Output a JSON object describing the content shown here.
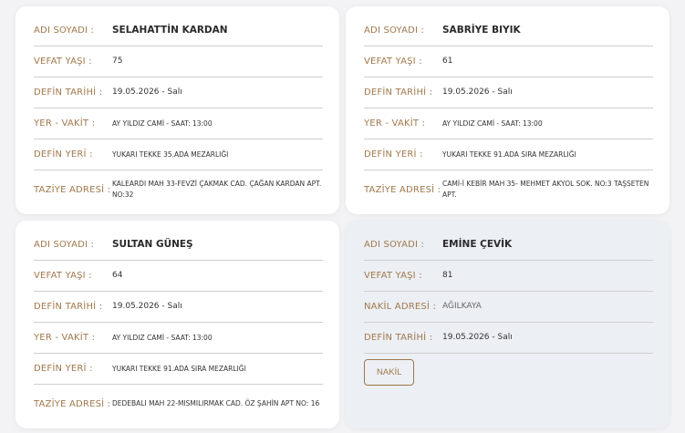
{
  "labels": {
    "name": "ADI SOYADI :",
    "age": "VEFAT YAŞI :",
    "date": "DEFİN TARİHİ :",
    "place_time": "YER - VAKİT :",
    "burial_place": "DEFİN YERİ :",
    "condolence": "TAZİYE ADRESİ :",
    "transfer": "NAKİL ADRESİ :",
    "transfer_button": "NAKİL"
  },
  "cards": [
    {
      "name": "SELAHATTİN KARDAN",
      "age": "75",
      "date": "19.05.2026 - Salı",
      "place_time": "AY YILDIZ CAMİ - SAAT: 13:00",
      "burial_place": "YUKARI TEKKE 35.ADA MEZARLIĞI",
      "condolence": "KALEARDI MAH 33-FEVZİ ÇAKMAK CAD. ÇAĞAN KARDAN APT. NO:32"
    },
    {
      "name": "SABRİYE BIYIK",
      "age": "61",
      "date": "19.05.2026 - Salı",
      "place_time": "AY YILDIZ CAMİ - SAAT: 13:00",
      "burial_place": "YUKARI TEKKE 91.ADA SIRA MEZARLIĞI",
      "condolence": "CAMİ-İ KEBİR MAH 35- MEHMET AKYOL SOK. NO:3 TAŞSETEN APT."
    },
    {
      "name": "SULTAN GÜNEŞ",
      "age": "64",
      "date": "19.05.2026 - Salı",
      "place_time": "AY YILDIZ CAMİ - SAAT: 13:00",
      "burial_place": "YUKARI TEKKE 91.ADA SIRA MEZARLIĞI",
      "condolence": "DEDEBALI MAH 22-MISMILIRMAK CAD. ÖZ ŞAHİN APT NO: 16"
    },
    {
      "name": "EMİNE ÇEVİK",
      "age": "81",
      "transfer": "AĞILKAYA",
      "date": "19.05.2026 - Salı"
    }
  ],
  "colors": {
    "label": "#a0784c",
    "card_bg": "#ffffff",
    "card_bg_transfer": "#eceff4"
  }
}
